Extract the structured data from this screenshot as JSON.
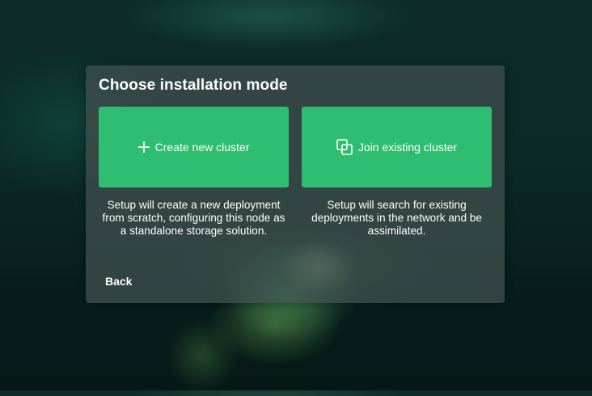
{
  "dialog": {
    "title": "Choose installation mode",
    "back_label": "Back"
  },
  "options": [
    {
      "label": "Create new cluster",
      "icon": "plus-icon",
      "description": "Setup will create a new deployment from scratch, configuring this node as a standalone storage solution."
    },
    {
      "label": "Join existing cluster",
      "icon": "join-squares-icon",
      "description": "Setup will search for existing deployments in the network and be assimilated."
    }
  ],
  "colors": {
    "accent": "#2fbd72",
    "panel": "#435250"
  }
}
